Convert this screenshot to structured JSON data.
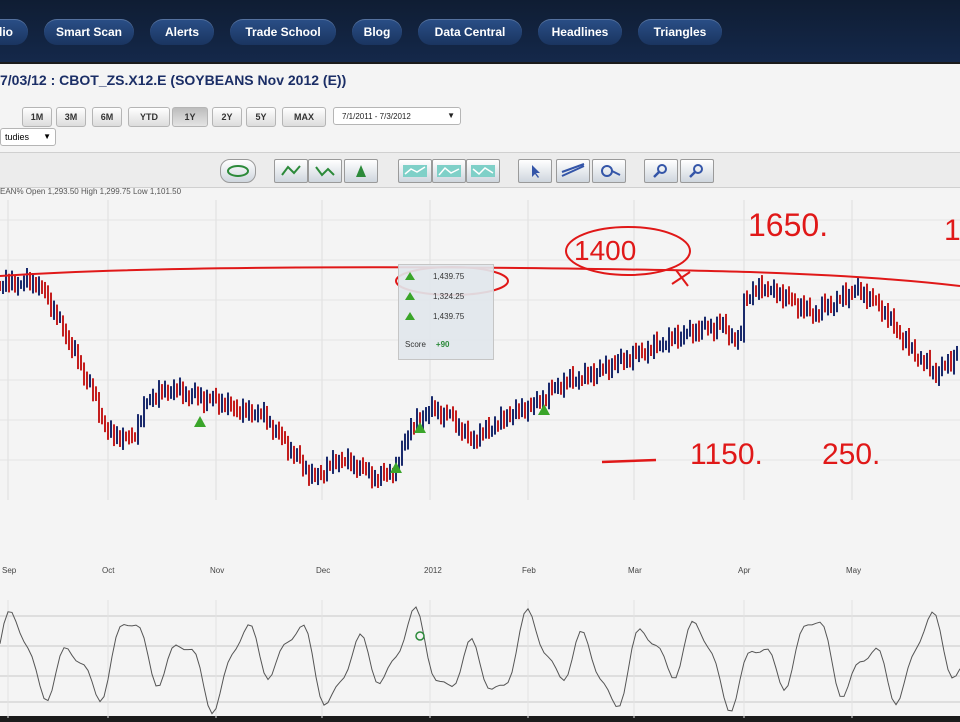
{
  "nav": {
    "items": [
      {
        "label": "lio"
      },
      {
        "label": "Smart Scan"
      },
      {
        "label": "Alerts"
      },
      {
        "label": "Trade School"
      },
      {
        "label": "Blog"
      },
      {
        "label": "Data Central"
      },
      {
        "label": "Headlines"
      },
      {
        "label": "Triangles"
      }
    ]
  },
  "chart_header": {
    "title": "7/03/12 : CBOT_ZS.X12.E (SOYBEANS Nov 2012 (E))",
    "ohlc": "EAN%     Open 1,293.50  High 1,299.75  Low 1,101.50"
  },
  "ranges": [
    "1M",
    "3M",
    "6M",
    "YTD",
    "1Y",
    "2Y",
    "5Y",
    "MAX"
  ],
  "selected_range": "1Y",
  "date_range": "7/1/2011 - 7/3/2012",
  "studies_label": "tudies",
  "toolbar_icons": [
    "chart-type-icon",
    "zoom-in-bars-icon",
    "zoom-out-bars-icon",
    "volume-icon",
    "line-chart-icon",
    "area-chart-icon",
    "trend-chart-icon",
    "select-cursor-icon",
    "draw-line-icon",
    "crosshair-icon",
    "zoom-in-icon",
    "zoom-out-icon"
  ],
  "tooltip": {
    "rows": [
      "1,439.75",
      "1,324.25",
      "1,439.75"
    ],
    "score_label": "Score",
    "score_value": "+90"
  },
  "x_axis_labels": [
    "Sep",
    "Oct",
    "Nov",
    "Dec",
    "2012",
    "Feb",
    "Mar",
    "Apr",
    "May"
  ],
  "annotations": {
    "circled": "1400",
    "top": "1650.",
    "bottom_left": "1150.",
    "bottom_right": "250.",
    "top_edge": "1"
  },
  "colors": {
    "nav_bg": "#13264a",
    "nav_button": "#1e3c6c",
    "title_text": "#1b2e66",
    "up_bar": "#1a2a6c",
    "down_bar": "#c41e1e",
    "annotation_red": "#e01818",
    "signal_green": "#3aa52a"
  },
  "chart_data": {
    "type": "line",
    "title": "CBOT_ZS.X12.E (SOYBEANS Nov 2012 (E))",
    "x": [
      "Sep",
      "Oct",
      "Nov",
      "Dec",
      "2012",
      "Feb",
      "Mar",
      "Apr",
      "May"
    ],
    "series": [
      {
        "name": "price",
        "values": [
          1438,
          1225,
          1180,
          1140,
          1235,
          1255,
          1330,
          1435,
          1325
        ]
      }
    ],
    "annotations": [
      {
        "text": "1400"
      },
      {
        "text": "1650."
      },
      {
        "text": "1150."
      },
      {
        "text": "250."
      }
    ]
  }
}
